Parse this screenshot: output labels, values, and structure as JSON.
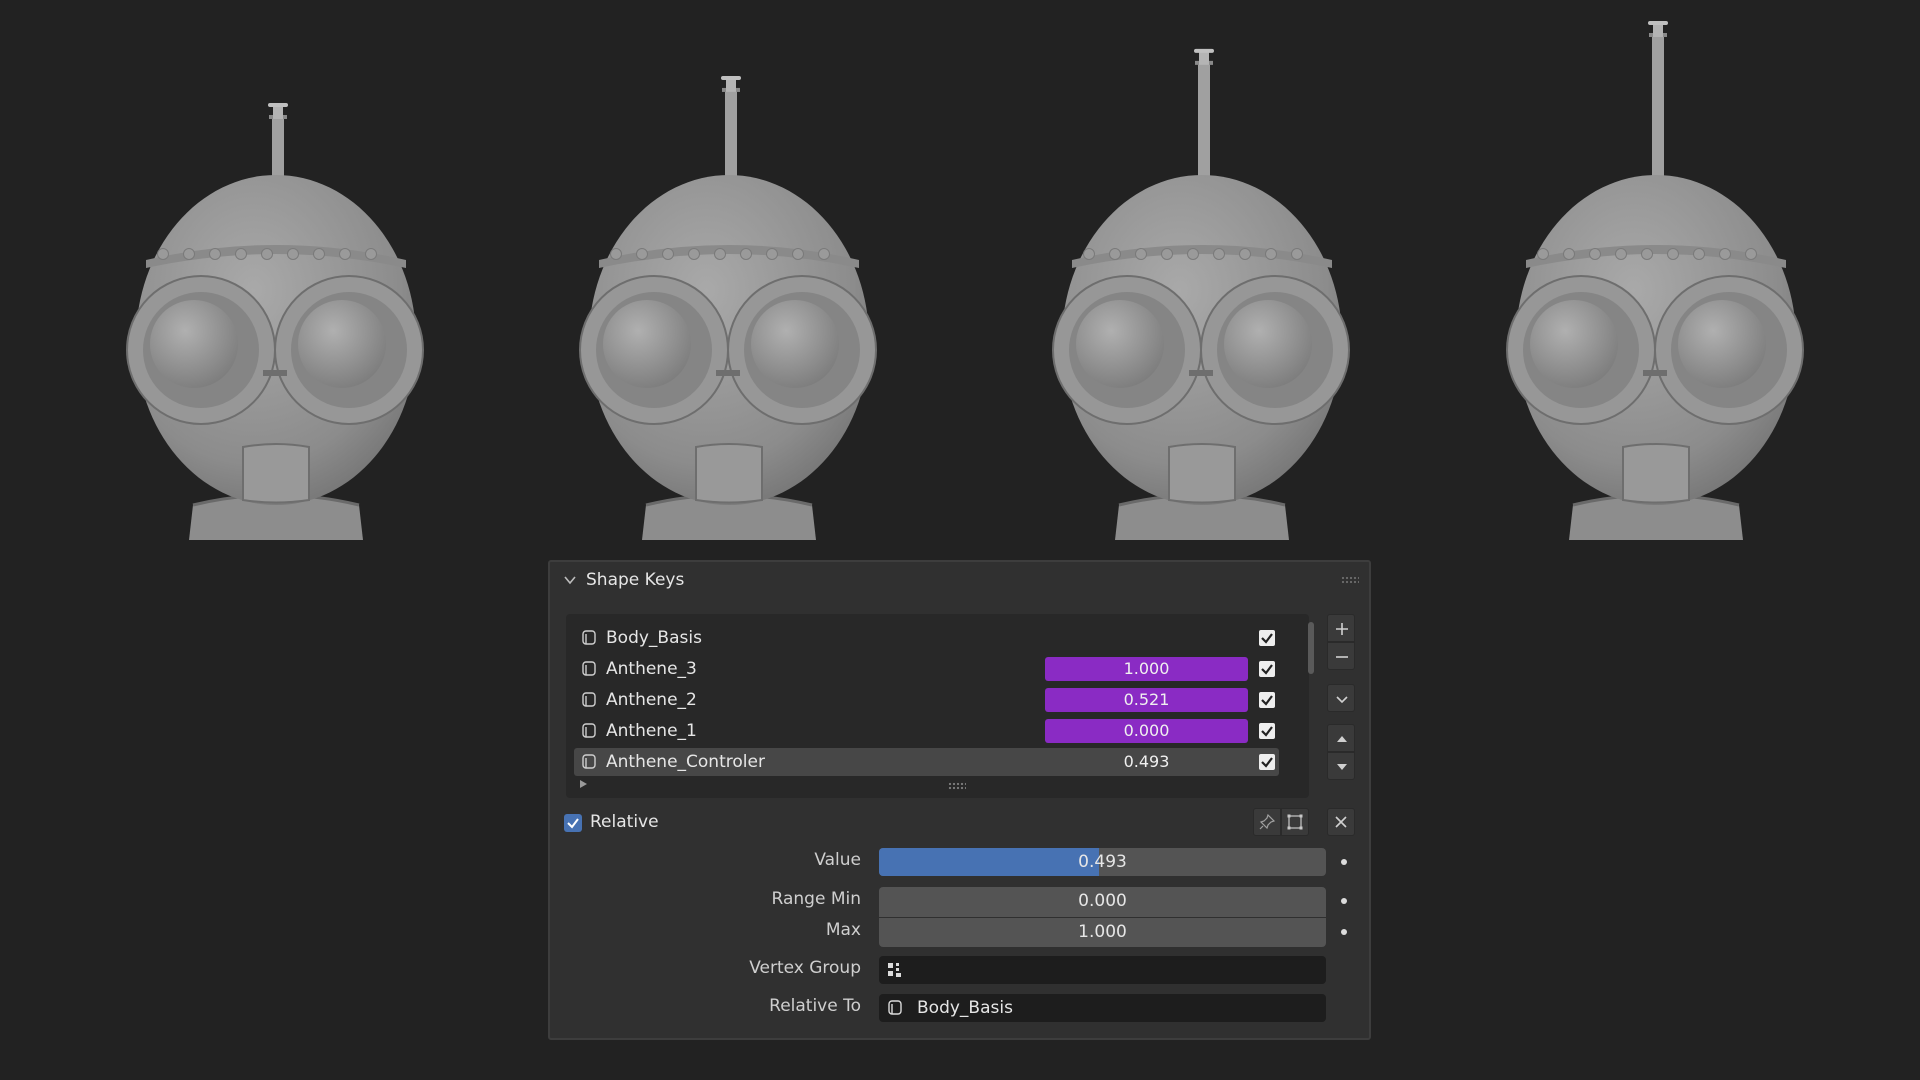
{
  "panel": {
    "title": "Shape Keys",
    "shape_keys": [
      {
        "name": "Body_Basis",
        "value": null,
        "enabled": true
      },
      {
        "name": "Anthene_3",
        "value": "1.000",
        "enabled": true
      },
      {
        "name": "Anthene_2",
        "value": "0.521",
        "enabled": true
      },
      {
        "name": "Anthene_1",
        "value": "0.000",
        "enabled": true
      },
      {
        "name": "Anthene_Controler",
        "value": "0.493",
        "enabled": true,
        "active": true
      }
    ],
    "relative_label": "Relative",
    "relative_checked": true,
    "props": {
      "value_label": "Value",
      "value": "0.493",
      "value_fraction": 0.493,
      "range_min_label": "Range Min",
      "range_min": "0.000",
      "max_label": "Max",
      "max": "1.000",
      "vertex_group_label": "Vertex Group",
      "vertex_group": "",
      "relative_to_label": "Relative To",
      "relative_to": "Body_Basis"
    },
    "colors": {
      "driven_value": "#8a2bc4",
      "slider_fill": "#4772b3",
      "panel_bg": "#303030",
      "viewport_bg": "#222222"
    },
    "icons": [
      "shapekey-icon",
      "checkbox-icon",
      "add-icon",
      "remove-icon",
      "menu-down-icon",
      "move-up-icon",
      "move-down-icon",
      "pin-icon",
      "edit-mode-icon",
      "clear-icon",
      "vertex-group-icon"
    ]
  },
  "viewport": {
    "robots": [
      {
        "antenna_extension": 0.0
      },
      {
        "antenna_extension": 0.33
      },
      {
        "antenna_extension": 0.66
      },
      {
        "antenna_extension": 1.0
      }
    ]
  }
}
